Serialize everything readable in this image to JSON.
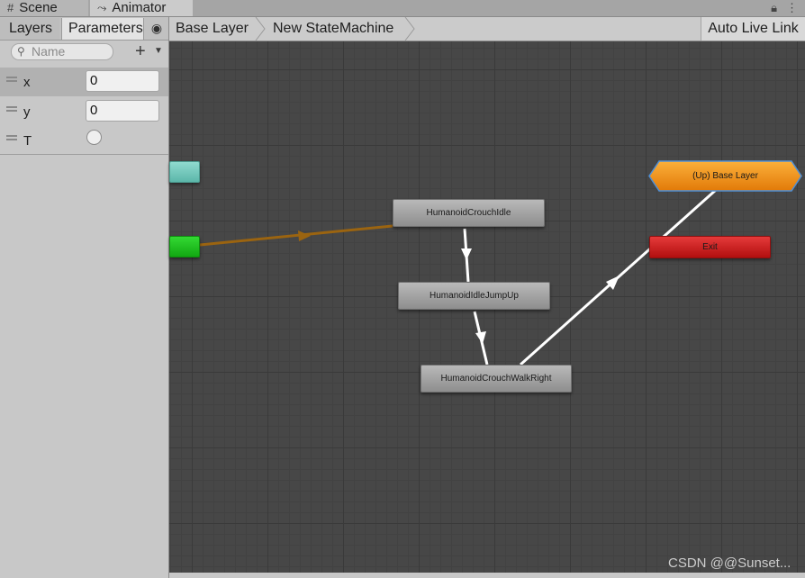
{
  "tabs": [
    {
      "label": "Scene",
      "icon": "grid-icon"
    },
    {
      "label": "Animator",
      "icon": "animator-icon"
    }
  ],
  "left_panel": {
    "tabs": [
      "Layers",
      "Parameters"
    ],
    "search_placeholder": "Name",
    "parameters": [
      {
        "name": "x",
        "type": "float",
        "value": "0"
      },
      {
        "name": "y",
        "type": "float",
        "value": "0"
      },
      {
        "name": "T",
        "type": "trigger",
        "value": ""
      }
    ]
  },
  "breadcrumb": [
    "Base Layer",
    "New StateMachine"
  ],
  "auto_live_link": "Auto Live Link",
  "states": {
    "crouch_idle": "HumanoidCrouchIdle",
    "idle_jump_up": "HumanoidIdleJumpUp",
    "crouch_walk_right": "HumanoidCrouchWalkRight",
    "up_base_layer": "(Up) Base Layer",
    "exit": "Exit"
  },
  "watermark": "CSDN @@Sunset...",
  "colors": {
    "graph_bg": "#474747",
    "entry": "#1fc41f",
    "any_state": "#6fc8bb",
    "exit": "#d01a1a",
    "up_layer": "#f08c14",
    "default_transition": "#9b6410",
    "transition": "#ffffff"
  }
}
